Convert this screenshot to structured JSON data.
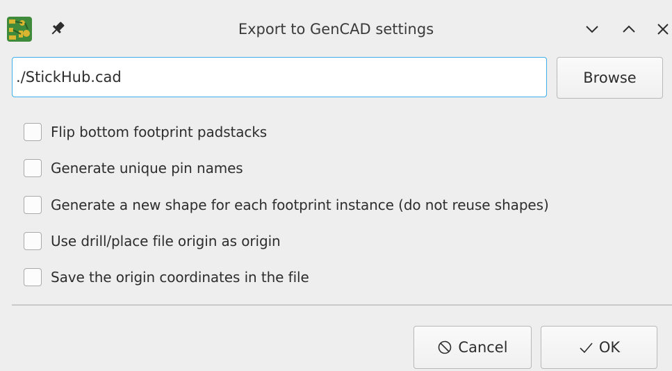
{
  "window": {
    "title": "Export to GenCAD settings"
  },
  "file": {
    "path": "./StickHub.cad",
    "browse_label": "Browse"
  },
  "options": [
    {
      "label": "Flip bottom footprint padstacks",
      "checked": false
    },
    {
      "label": "Generate unique pin names",
      "checked": false
    },
    {
      "label": "Generate a new shape for each footprint instance (do not reuse shapes)",
      "checked": false
    },
    {
      "label": "Use drill/place file origin as origin",
      "checked": false
    },
    {
      "label": "Save the origin coordinates in the file",
      "checked": false
    }
  ],
  "buttons": {
    "cancel_label": "Cancel",
    "ok_label": "OK"
  },
  "colors": {
    "accent": "#3daee9",
    "background": "#eeeeef",
    "app_icon_green": "#3f8a3b",
    "app_icon_yellow": "#d9b530"
  }
}
